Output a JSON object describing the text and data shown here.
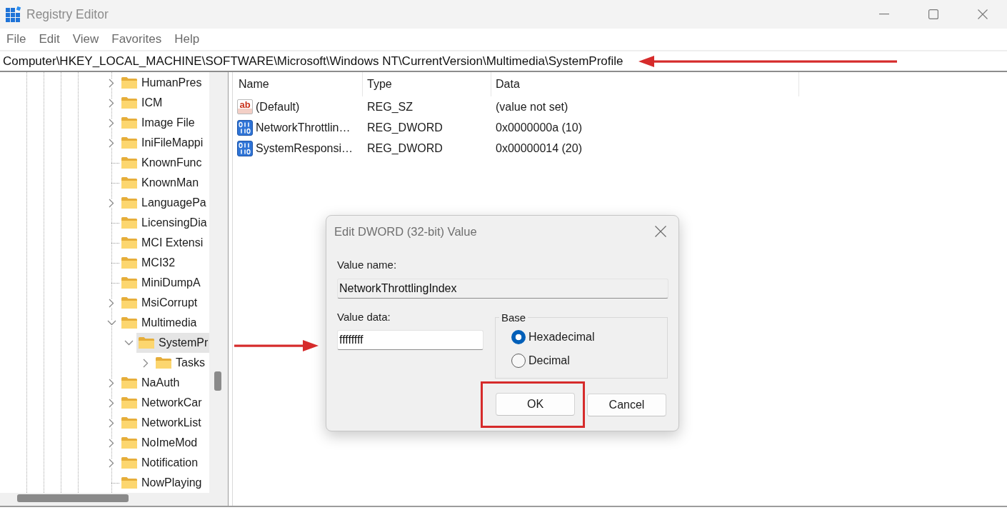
{
  "window": {
    "title": "Registry Editor"
  },
  "menu": [
    "File",
    "Edit",
    "View",
    "Favorites",
    "Help"
  ],
  "address_bar": {
    "path": "Computer\\HKEY_LOCAL_MACHINE\\SOFTWARE\\Microsoft\\Windows NT\\CurrentVersion\\Multimedia\\SystemProfile",
    "annotated": true
  },
  "tree": {
    "items": [
      {
        "label": "HumanPres",
        "expandable": true,
        "expanded": false,
        "selected": false
      },
      {
        "label": "ICM",
        "expandable": true,
        "expanded": false,
        "selected": false
      },
      {
        "label": "Image File",
        "expandable": true,
        "expanded": false,
        "selected": false
      },
      {
        "label": "IniFileMappi",
        "expandable": true,
        "expanded": false,
        "selected": false
      },
      {
        "label": "KnownFunc",
        "expandable": false,
        "expanded": false,
        "selected": false
      },
      {
        "label": "KnownMan",
        "expandable": false,
        "expanded": false,
        "selected": false
      },
      {
        "label": "LanguagePa",
        "expandable": true,
        "expanded": false,
        "selected": false
      },
      {
        "label": "LicensingDia",
        "expandable": false,
        "expanded": false,
        "selected": false
      },
      {
        "label": "MCI Extensi",
        "expandable": false,
        "expanded": false,
        "selected": false
      },
      {
        "label": "MCI32",
        "expandable": false,
        "expanded": false,
        "selected": false
      },
      {
        "label": "MiniDumpA",
        "expandable": false,
        "expanded": false,
        "selected": false
      },
      {
        "label": "MsiCorrupt",
        "expandable": true,
        "expanded": false,
        "selected": false
      },
      {
        "label": "Multimedia",
        "expandable": true,
        "expanded": true,
        "selected": false,
        "children": [
          {
            "label": "SystemPr",
            "expandable": true,
            "expanded": true,
            "selected": true,
            "children": [
              {
                "label": "Tasks",
                "expandable": true,
                "expanded": false,
                "selected": false
              }
            ]
          }
        ]
      },
      {
        "label": "NaAuth",
        "expandable": true,
        "expanded": false,
        "selected": false
      },
      {
        "label": "NetworkCar",
        "expandable": true,
        "expanded": false,
        "selected": false
      },
      {
        "label": "NetworkList",
        "expandable": true,
        "expanded": false,
        "selected": false
      },
      {
        "label": "NoImeMod",
        "expandable": true,
        "expanded": false,
        "selected": false
      },
      {
        "label": "Notification",
        "expandable": true,
        "expanded": false,
        "selected": false
      },
      {
        "label": "NowPlaying",
        "expandable": false,
        "expanded": false,
        "selected": false
      }
    ]
  },
  "values": {
    "columns": [
      "Name",
      "Type",
      "Data"
    ],
    "rows": [
      {
        "kind": "string",
        "icon_label": "ab",
        "name": "(Default)",
        "type": "REG_SZ",
        "data": "(value not set)",
        "selected": false
      },
      {
        "kind": "dword",
        "name": "NetworkThrottlin…",
        "type": "REG_DWORD",
        "data": "0x0000000a (10)",
        "selected": false
      },
      {
        "kind": "dword",
        "name": "SystemResponsi…",
        "type": "REG_DWORD",
        "data": "0x00000014 (20)",
        "selected": false
      }
    ]
  },
  "dialog": {
    "title": "Edit DWORD (32-bit) Value",
    "value_name": {
      "label": "Value name:",
      "value": "NetworkThrottlingIndex",
      "read_only": true
    },
    "value_data": {
      "label": "Value data:",
      "value": "ffffffff",
      "read_only": false,
      "annotated": true
    },
    "base": {
      "title": "Base",
      "options": [
        {
          "label": "Hexadecimal",
          "selected": true
        },
        {
          "label": "Decimal",
          "selected": false
        }
      ]
    },
    "buttons": [
      {
        "label": "OK",
        "highlighted": true
      },
      {
        "label": "Cancel",
        "highlighted": false
      }
    ]
  }
}
